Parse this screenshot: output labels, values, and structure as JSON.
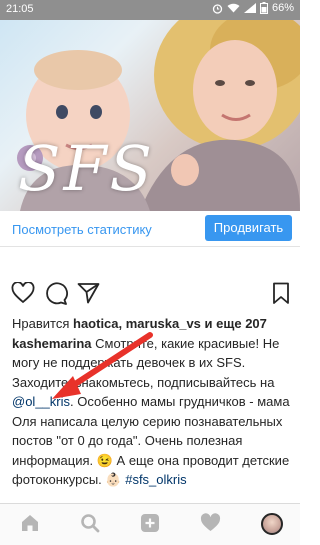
{
  "status_bar": {
    "time": "21:05",
    "battery": "66%",
    "icons": [
      "wifi-icon",
      "signal-icon",
      "battery-icon",
      "alarm-icon"
    ]
  },
  "photo": {
    "overlay_text": "SFS"
  },
  "promo": {
    "stats_link": "Посмотреть статистику",
    "promote_button": "Продвигать",
    "accent_color": "#3897f0"
  },
  "actions": {
    "icons": [
      "heart-icon",
      "comment-icon",
      "share-icon",
      "bookmark-icon"
    ]
  },
  "likes": {
    "prefix": "Нравится",
    "users": "haotica, maruska_vs",
    "middle": "и",
    "count": "еще 207"
  },
  "caption": {
    "username": "kashemarina",
    "part1": "Смотрите, какие красивые! Не могу не поддержать девочек в их SFS. Заходите, знакомьтесь, подписывайтесь на",
    "mention": "@ol__kris",
    "part2": ". Особенно мамы грудничков - мама Оля написала целую серию познавательных постов \"от 0 до года\". Очень полезная информация. 😉 А еще она проводит детские фотоконкурсы. 👶🏻",
    "hashtag": "#sfs_olkris"
  },
  "bottom_nav": {
    "items": [
      "home-icon",
      "search-icon",
      "add-icon",
      "activity-heart-icon",
      "profile-avatar"
    ]
  }
}
